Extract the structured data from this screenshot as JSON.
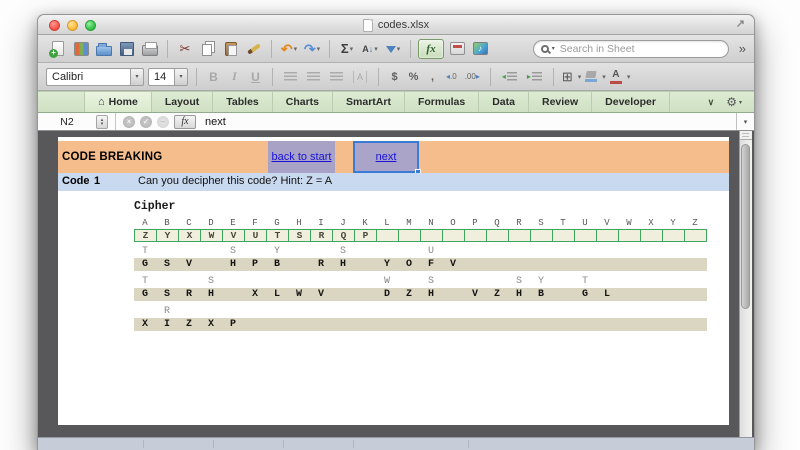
{
  "window": {
    "title": "codes.xlsx"
  },
  "toolbar": {
    "search_placeholder": "Search in Sheet"
  },
  "format_bar": {
    "font_name": "Calibri",
    "font_size": "14"
  },
  "ribbon": {
    "tabs": [
      "Home",
      "Layout",
      "Tables",
      "Charts",
      "SmartArt",
      "Formulas",
      "Data",
      "Review",
      "Developer"
    ],
    "active_tab": "Home"
  },
  "formula_bar": {
    "cell_ref": "N2",
    "formula": "next",
    "fx_label": "fx"
  },
  "glyphs": {
    "home": "⌂",
    "caret": "▾",
    "chevron_double": "»",
    "gear": "⚙",
    "collapse": "∨",
    "scissors": "✂",
    "undo": "↶",
    "redo": "↷",
    "sigma": "Σ",
    "sort_letter": "A",
    "sort_arrow": "↓",
    "expand": "↗",
    "cancel": "×",
    "accept": "✓",
    "dash": "–",
    "stepper_up": "▴",
    "stepper_down": "▾",
    "bold": "B",
    "italic": "I",
    "underline": "U",
    "currency": "$",
    "percent": "%",
    "comma": ",",
    "borders": "⊞",
    "font_color_letter": "A",
    "wrap": "A",
    "music": "♪",
    "arrow_left": "◂",
    "arrow_right": "▸",
    "dec_inc": ".0",
    "dec_dec": ".00"
  },
  "sheet": {
    "title_row": {
      "title": "CODE BREAKING",
      "back_link": "back to start",
      "next_link": "next"
    },
    "code_row": {
      "label": "Code",
      "number": "1",
      "question": "Can you decipher this code? Hint: Z = A"
    },
    "cipher": {
      "label": "Cipher",
      "alphabet": [
        "A",
        "B",
        "C",
        "D",
        "E",
        "F",
        "G",
        "H",
        "I",
        "J",
        "K",
        "L",
        "M",
        "N",
        "O",
        "P",
        "Q",
        "R",
        "S",
        "T",
        "U",
        "V",
        "W",
        "X",
        "Y",
        "Z"
      ],
      "mapping": [
        "Z",
        "Y",
        "X",
        "W",
        "V",
        "U",
        "T",
        "S",
        "R",
        "Q",
        "P",
        "",
        "",
        "",
        "",
        "",
        "",
        "",
        "",
        "",
        "",
        "",
        "",
        "",
        "",
        ""
      ]
    },
    "messages": [
      {
        "answer_row": [
          "T",
          "",
          "",
          "",
          "S",
          "",
          "Y",
          "",
          "",
          "S",
          "",
          "",
          "",
          "U",
          "",
          "",
          "",
          "",
          "",
          "",
          "",
          "",
          "",
          "",
          "",
          ""
        ],
        "cipher_row": [
          "G",
          "S",
          "V",
          "",
          "H",
          "P",
          "B",
          "",
          "R",
          "H",
          "",
          "Y",
          "O",
          "F",
          "V",
          "",
          "",
          "",
          "",
          "",
          "",
          "",
          "",
          "",
          "",
          ""
        ]
      },
      {
        "answer_row": [
          "T",
          "",
          "",
          "S",
          "",
          "",
          "",
          "",
          "",
          "",
          "",
          "W",
          "",
          "S",
          "",
          "",
          "",
          "S",
          "Y",
          "",
          "T",
          "",
          "",
          "",
          "",
          ""
        ],
        "cipher_row": [
          "G",
          "S",
          "R",
          "H",
          "",
          "X",
          "L",
          "W",
          "V",
          "",
          "",
          "D",
          "Z",
          "H",
          "",
          "V",
          "Z",
          "H",
          "B",
          "",
          "G",
          "L",
          "",
          "",
          "",
          ""
        ]
      },
      {
        "answer_row": [
          "",
          "R",
          "",
          "",
          "",
          "",
          "",
          "",
          "",
          "",
          "",
          "",
          "",
          "",
          "",
          "",
          "",
          "",
          "",
          "",
          "",
          "",
          "",
          "",
          "",
          ""
        ],
        "cipher_row": [
          "X",
          "I",
          "Z",
          "X",
          "P",
          "",
          "",
          "",
          "",
          "",
          "",
          "",
          "",
          "",
          "",
          "",
          "",
          "",
          "",
          "",
          "",
          "",
          "",
          "",
          "",
          ""
        ]
      }
    ]
  },
  "colors": {
    "header_orange": "#f5bd8c",
    "button_purple": "#a7a2c6",
    "code_blue": "#c9d9f0",
    "message_tan": "#dbd6c1",
    "cipher_cell_bg": "#f0eedd",
    "cipher_border": "#3fa45c",
    "link_blue": "#1a12d8",
    "selection_blue": "#3a7bd5",
    "ribbon_green": "#d6e6cb"
  }
}
